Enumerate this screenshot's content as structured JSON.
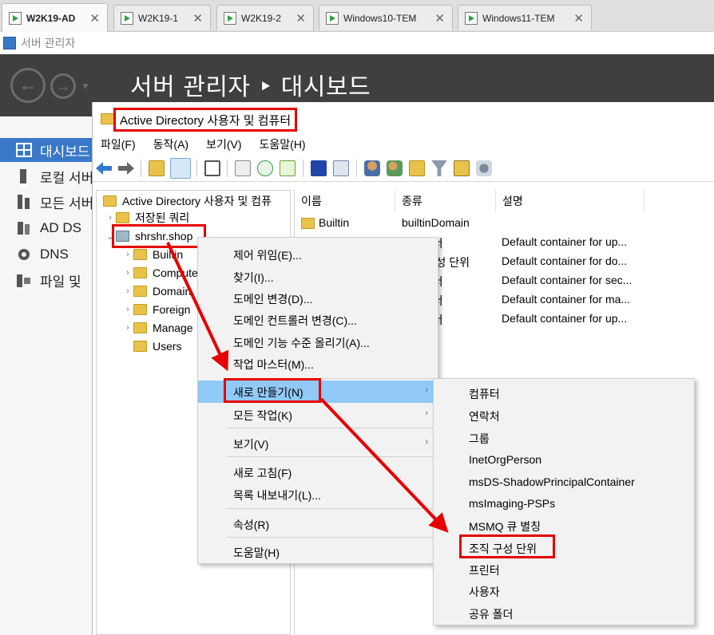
{
  "vm_tabs": [
    {
      "label": "W2K19-AD",
      "active": true
    },
    {
      "label": "W2K19-1",
      "active": false
    },
    {
      "label": "W2K19-2",
      "active": false
    },
    {
      "label": "Windows10-TEM",
      "active": false
    },
    {
      "label": "Windows11-TEM",
      "active": false
    }
  ],
  "close_glyph": "✕",
  "server_manager": {
    "strip_title": "서버 관리자",
    "breadcrumb": "서버 관리자 ‣ 대시보드",
    "nav": [
      {
        "label": "대시보드",
        "icon": "dashboard-icon",
        "selected": true
      },
      {
        "label": "로컬 서버",
        "icon": "local-server-icon",
        "selected": false
      },
      {
        "label": "모든 서버",
        "icon": "all-servers-icon",
        "selected": false
      },
      {
        "label": "AD DS",
        "icon": "ad-ds-icon",
        "selected": false
      },
      {
        "label": "DNS",
        "icon": "dns-icon",
        "selected": false
      },
      {
        "label": "파일 및",
        "icon": "file-services-icon",
        "selected": false
      }
    ]
  },
  "aduc": {
    "window_title": "Active Directory 사용자 및 컴퓨터",
    "menu": [
      "파일(F)",
      "동작(A)",
      "보기(V)",
      "도움말(H)"
    ],
    "tree": {
      "root": "Active Directory 사용자 및 컴퓨",
      "saved_queries": "저장된 쿼리",
      "domain": "shrshr.shop",
      "children": [
        "Builtin",
        "Computers",
        "Domain",
        "Foreign",
        "Manage",
        "Users"
      ]
    },
    "columns": [
      "이름",
      "종류",
      "설명"
    ],
    "rows": [
      {
        "name": "Builtin",
        "type": "builtinDomain",
        "desc": ""
      },
      {
        "name": "",
        "type": "컨테이너",
        "desc": "Default container for up..."
      },
      {
        "name": "",
        "type": "조직 구성 단위",
        "desc": "Default container for do..."
      },
      {
        "name": "",
        "type": "컨테이너",
        "desc": "Default container for sec..."
      },
      {
        "name": "",
        "type": "컨테이너",
        "desc": "Default container for ma..."
      },
      {
        "name": "",
        "type": "컨테이너",
        "desc": "Default container for up..."
      }
    ]
  },
  "context_menu": {
    "items": [
      {
        "label": "제어 위임(E)...",
        "has_submenu": false
      },
      {
        "label": "찾기(I)...",
        "has_submenu": false
      },
      {
        "label": "도메인 변경(D)...",
        "has_submenu": false
      },
      {
        "label": "도메인 컨트롤러 변경(C)...",
        "has_submenu": false
      },
      {
        "label": "도메인 기능 수준 올리기(A)...",
        "has_submenu": false
      },
      {
        "label": "작업 마스터(M)...",
        "has_submenu": false
      },
      {
        "label": "새로 만들기(N)",
        "has_submenu": true,
        "highlighted": true
      },
      {
        "label": "모든 작업(K)",
        "has_submenu": true
      },
      {
        "label": "보기(V)",
        "has_submenu": true
      },
      {
        "label": "새로 고침(F)",
        "has_submenu": false
      },
      {
        "label": "목록 내보내기(L)...",
        "has_submenu": false
      },
      {
        "label": "속성(R)",
        "has_submenu": false
      },
      {
        "label": "도움말(H)",
        "has_submenu": false
      }
    ],
    "submenu_arrow": "›"
  },
  "new_submenu": {
    "items": [
      "컴퓨터",
      "연락처",
      "그룹",
      "InetOrgPerson",
      "msDS-ShadowPrincipalContainer",
      "msImaging-PSPs",
      "MSMQ 큐 별칭",
      "조직 구성 단위",
      "프린터",
      "사용자",
      "공유 폴더"
    ]
  },
  "colors": {
    "highlight": "#91c9f7",
    "annotation_red": "#e60000",
    "nav_selected": "#3a79c8",
    "banner": "#3f3f3f"
  }
}
